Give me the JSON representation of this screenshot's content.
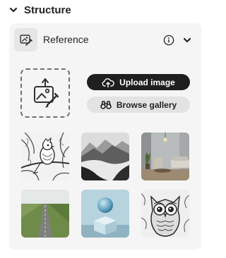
{
  "section": {
    "title": "Structure",
    "chevron_icon": "chevron-down-icon"
  },
  "reference": {
    "label": "Reference",
    "icon": "image-reference-icon",
    "info_icon": "info-icon",
    "collapse_icon": "chevron-down-icon"
  },
  "upload": {
    "drop_icon": "image-upload-icon",
    "upload_label": "Upload image",
    "upload_icon": "cloud-upload-icon",
    "browse_label": "Browse gallery",
    "browse_icon": "binoculars-icon"
  },
  "gallery": [
    {
      "name": "bird-sketch"
    },
    {
      "name": "misty-lake"
    },
    {
      "name": "living-room"
    },
    {
      "name": "runway-field"
    },
    {
      "name": "sphere-on-cube"
    },
    {
      "name": "owl-drawing"
    }
  ],
  "colors": {
    "button_dark": "#1f1f1f",
    "button_light": "#e3e3e3",
    "panel": "#f5f5f5"
  }
}
